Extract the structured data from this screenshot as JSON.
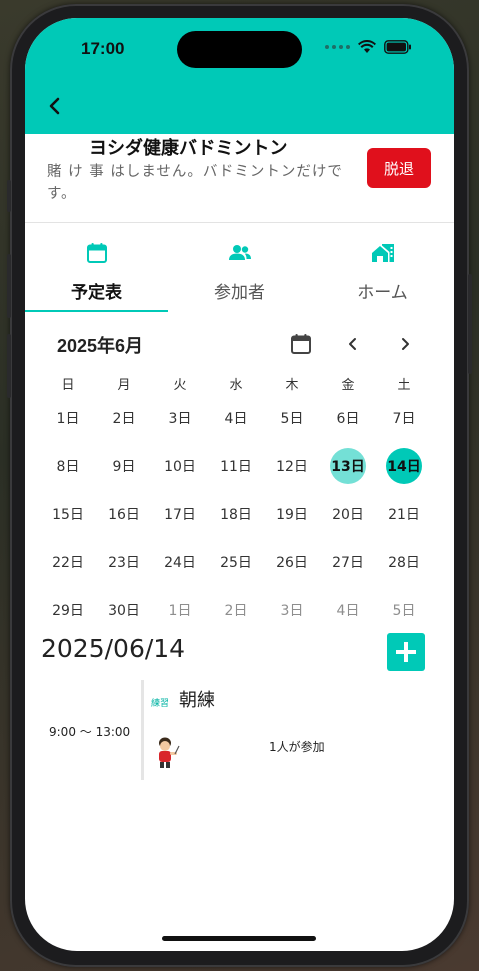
{
  "status_bar": {
    "time": "17:00"
  },
  "group": {
    "title": "ヨシダ健康バドミントン",
    "description": "賭 け 事 はしません。バドミントンだけです。",
    "leave_label": "脱退"
  },
  "tabs": [
    {
      "label": "予定表",
      "icon": "calendar-icon",
      "active": true
    },
    {
      "label": "参加者",
      "icon": "people-icon",
      "active": false
    },
    {
      "label": "ホーム",
      "icon": "home-icon",
      "active": false
    }
  ],
  "calendar": {
    "month_label": "2025年6月",
    "weekdays": [
      "日",
      "月",
      "火",
      "水",
      "木",
      "金",
      "土"
    ],
    "weeks": [
      [
        "1日",
        "2日",
        "3日",
        "4日",
        "5日",
        "6日",
        "7日"
      ],
      [
        "8日",
        "9日",
        "10日",
        "11日",
        "12日",
        "13日",
        "14日"
      ],
      [
        "15日",
        "16日",
        "17日",
        "18日",
        "19日",
        "20日",
        "21日"
      ],
      [
        "22日",
        "23日",
        "24日",
        "25日",
        "26日",
        "27日",
        "28日"
      ],
      [
        "29日",
        "30日",
        "1日",
        "2日",
        "3日",
        "4日",
        "5日"
      ]
    ],
    "today": "13日",
    "selected": "14日"
  },
  "selected_date": "2025/06/14",
  "event": {
    "time": "9:00 ～ 13:00",
    "tag": "練習",
    "title": "朝練",
    "participants": "1人が参加"
  },
  "colors": {
    "accent": "#00c9b7",
    "today": "#74e0d6",
    "danger": "#e0101c"
  }
}
